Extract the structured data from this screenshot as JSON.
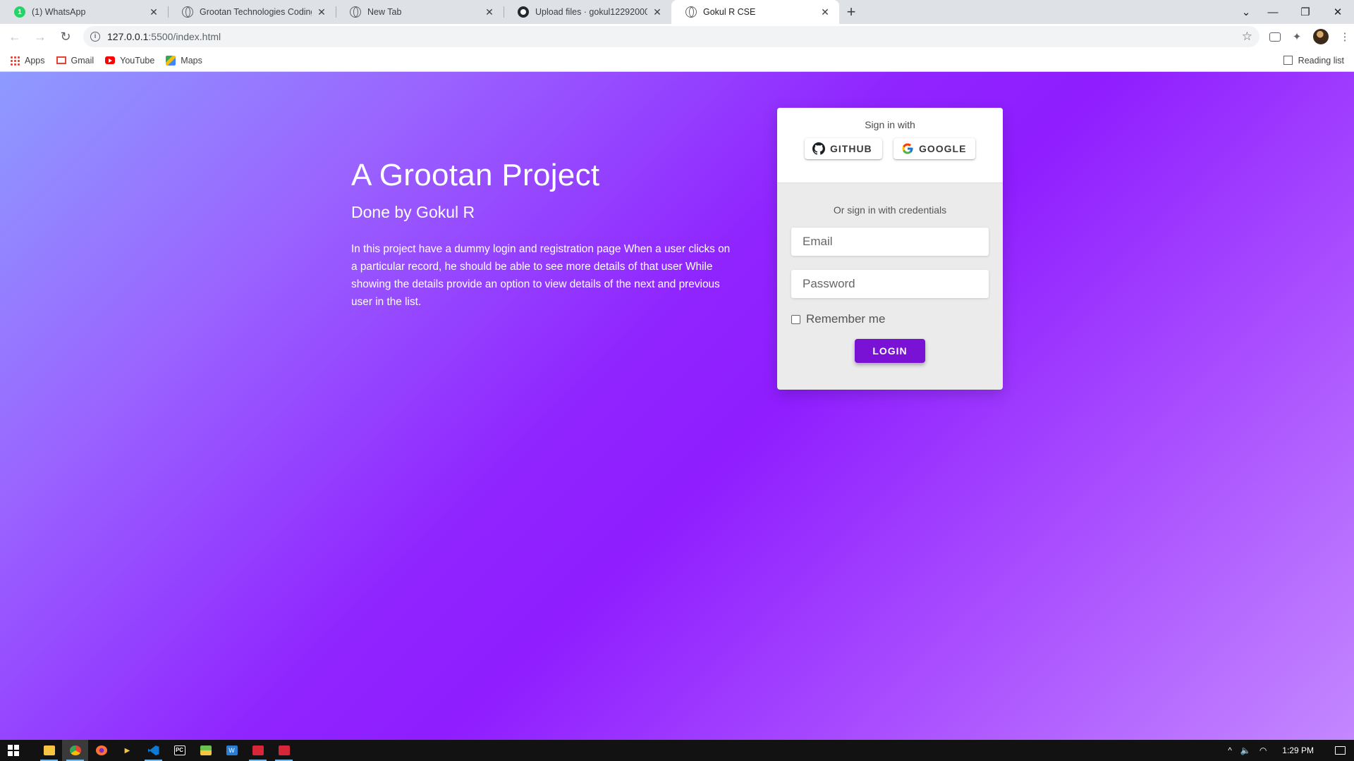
{
  "browser": {
    "tabs": [
      {
        "title": "(1) WhatsApp",
        "icon": "whatsapp-icon",
        "active": false
      },
      {
        "title": "Grootan Technologies Coding Ta",
        "icon": "globe-icon",
        "active": false
      },
      {
        "title": "New Tab",
        "icon": "globe-icon",
        "active": false
      },
      {
        "title": "Upload files · gokul12292000/Go",
        "icon": "github-icon",
        "active": false
      },
      {
        "title": "Gokul R CSE",
        "icon": "globe-icon",
        "active": true
      }
    ],
    "url_host": "127.0.0.1",
    "url_rest": ":5500/index.html",
    "bookmarks": [
      "Apps",
      "Gmail",
      "YouTube",
      "Maps"
    ],
    "reading_list": "Reading list"
  },
  "hero": {
    "title": "A Grootan Project",
    "subtitle": "Done by Gokul R",
    "description": "In this project have a dummy login and registration page When a user clicks on a particular record, he should be able to see more details of that user While showing the details provide an option to view details of the next and previous user in the list."
  },
  "login": {
    "sign_in_with": "Sign in with",
    "github_label": "GITHUB",
    "google_label": "GOOGLE",
    "or_credentials": "Or sign in with credentials",
    "email_placeholder": "Email",
    "password_placeholder": "Password",
    "remember_label": "Remember me",
    "login_button": "LOGIN"
  },
  "taskbar": {
    "time": "1:29 PM"
  },
  "colors": {
    "gradient_start": "#8e9bff",
    "gradient_mid": "#8f1dff",
    "gradient_end": "#c387ff",
    "login_button": "#7a12d6"
  }
}
